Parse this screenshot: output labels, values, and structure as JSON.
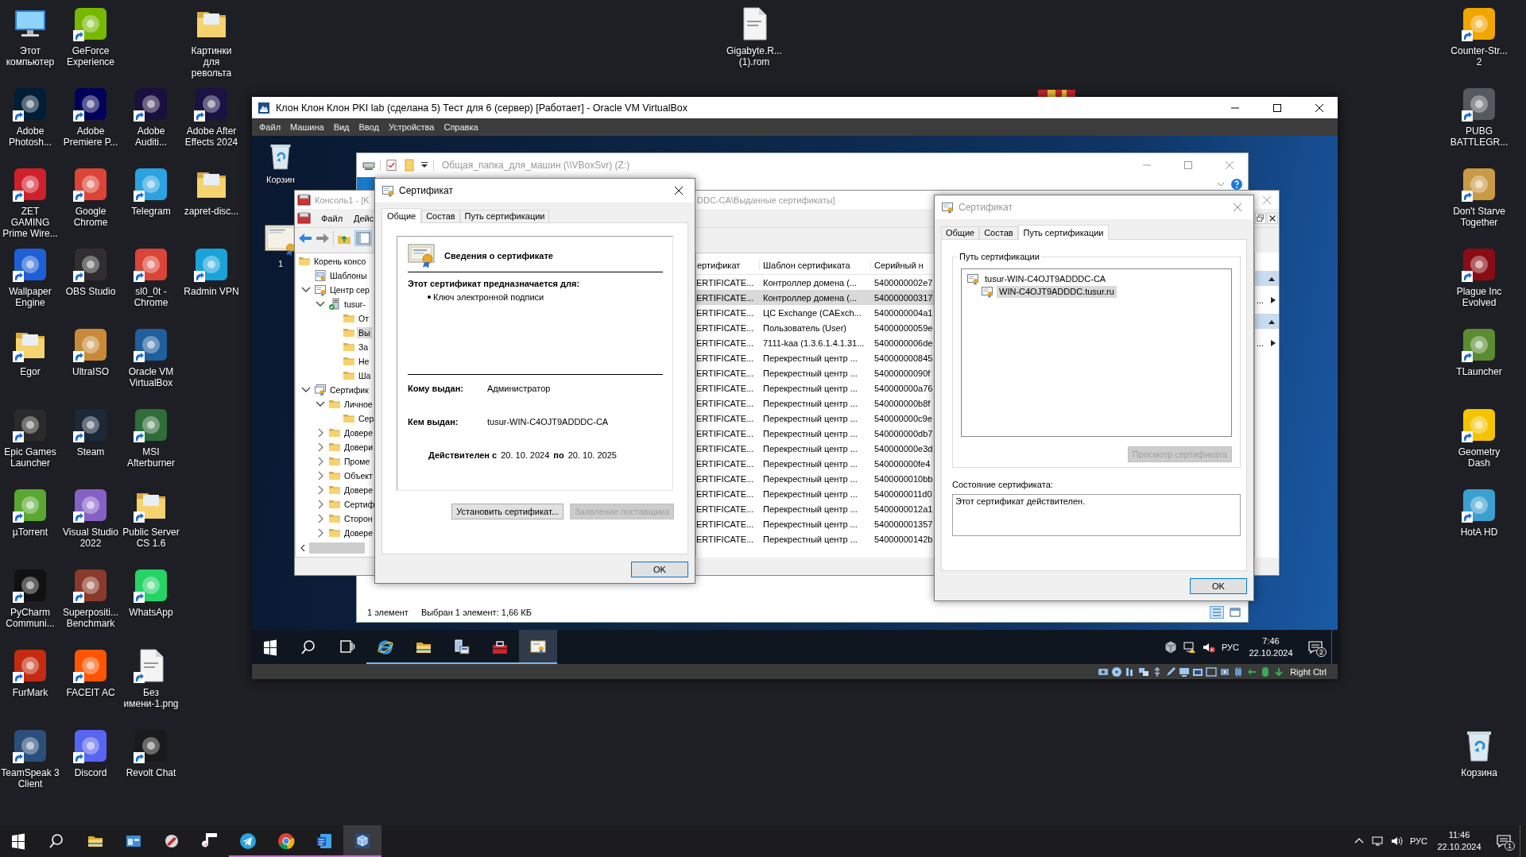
{
  "desktop_columns": [
    [
      {
        "label": "Этот компьютер",
        "kind": "computer",
        "shortcut": false
      },
      {
        "label": "Adobe Photosh...",
        "kind": "app",
        "color": "#001e36",
        "shortcut": true
      },
      {
        "label": "ZET GAMING Prime Wire...",
        "kind": "app",
        "color": "#d0202a",
        "shortcut": true
      },
      {
        "label": "Wallpaper Engine",
        "kind": "app",
        "color": "#1f5fd6",
        "shortcut": true
      },
      {
        "label": "Egor",
        "kind": "folder",
        "shortcut": true
      },
      {
        "label": "Epic Games Launcher",
        "kind": "app",
        "color": "#2a2a2a",
        "shortcut": true
      },
      {
        "label": "µTorrent",
        "kind": "app",
        "color": "#5aa832",
        "shortcut": true
      },
      {
        "label": "PyCharm Communi...",
        "kind": "app",
        "color": "#111111",
        "shortcut": true
      },
      {
        "label": "FurMark",
        "kind": "app",
        "color": "#c42b10",
        "shortcut": true
      },
      {
        "label": "TeamSpeak 3 Client",
        "kind": "app",
        "color": "#2b4f7a",
        "shortcut": true
      }
    ],
    [
      {
        "label": "GeForce Experience",
        "kind": "app",
        "color": "#76b900",
        "shortcut": true
      },
      {
        "label": "Adobe Premiere P...",
        "kind": "app",
        "color": "#00005b",
        "shortcut": true
      },
      {
        "label": "Google Chrome",
        "kind": "app",
        "color": "#db4437",
        "shortcut": true
      },
      {
        "label": "OBS Studio",
        "kind": "app",
        "color": "#302e31",
        "shortcut": true
      },
      {
        "label": "UltraISO",
        "kind": "app",
        "color": "#c88a3a",
        "shortcut": true
      },
      {
        "label": "Steam",
        "kind": "app",
        "color": "#1b2838",
        "shortcut": true
      },
      {
        "label": "Visual Studio 2022",
        "kind": "app",
        "color": "#8661c5",
        "shortcut": true
      },
      {
        "label": "Superpositi... Benchmark",
        "kind": "app",
        "color": "#8a3a2a",
        "shortcut": true
      },
      {
        "label": "FACEIT AC",
        "kind": "app",
        "color": "#ff5500",
        "shortcut": true
      },
      {
        "label": "Discord",
        "kind": "app",
        "color": "#5865f2",
        "shortcut": true
      }
    ],
    [
      {
        "label": "Adobe Auditi...",
        "kind": "app",
        "color": "#1a0f3f",
        "shortcut": true
      },
      {
        "label": "Telegram",
        "kind": "app",
        "color": "#2aa3e0",
        "shortcut": true
      },
      {
        "label": "sl0_0t - Chrome",
        "kind": "app",
        "color": "#db4438",
        "shortcut": true
      },
      {
        "label": "Oracle VM VirtualBox",
        "kind": "app",
        "color": "#1f5f9e",
        "shortcut": true
      },
      {
        "label": "MSI Afterburner",
        "kind": "app",
        "color": "#2f6d3a",
        "shortcut": true
      },
      {
        "label": "Public Server CS 1.6",
        "kind": "folder",
        "shortcut": true
      },
      {
        "label": "WhatsApp",
        "kind": "app",
        "color": "#25d366",
        "shortcut": true
      },
      {
        "label": "Без имени-1.png",
        "kind": "file",
        "shortcut": true
      },
      {
        "label": "Revolt Chat",
        "kind": "app",
        "color": "#1a1a1a",
        "shortcut": true
      }
    ],
    [
      {
        "label": "Картинки для револьта",
        "kind": "folder",
        "shortcut": false
      },
      {
        "label": "Adobe After Effects 2024",
        "kind": "app",
        "color": "#1a1145",
        "shortcut": true
      },
      {
        "label": "zapret-disc...",
        "kind": "folder",
        "shortcut": false
      },
      {
        "label": "Radmin VPN",
        "kind": "app",
        "color": "#1aa3d9",
        "shortcut": true
      }
    ]
  ],
  "desktop_file": {
    "label": "Gigabyte.R... (1).rom",
    "kind": "file",
    "shortcut": false
  },
  "desktop_right": [
    {
      "label": "Counter-Str... 2",
      "kind": "app",
      "color": "#f0a500",
      "shortcut": true
    },
    {
      "label": "PUBG BATTLEGR...",
      "kind": "app",
      "color": "#555a60",
      "shortcut": true
    },
    {
      "label": "Don't Starve Together",
      "kind": "app",
      "color": "#c99a45",
      "shortcut": true
    },
    {
      "label": "Plague Inc Evolved",
      "kind": "app",
      "color": "#8a0d14",
      "shortcut": true
    },
    {
      "label": "TLauncher",
      "kind": "app",
      "color": "#5b8c32",
      "shortcut": true
    },
    {
      "label": "Geometry Dash",
      "kind": "app",
      "color": "#f5c400",
      "shortcut": true
    },
    {
      "label": "HotA HD",
      "kind": "app",
      "color": "#3ba0d0",
      "shortcut": true
    }
  ],
  "recycle_bin": {
    "label": "Корзина",
    "kind": "bin",
    "shortcut": false
  },
  "vbox": {
    "title": "Клон Клон Клон PKI lab (сделана 5) Тест для 6 (сервер) [Работает] - Oracle VM VirtualBox",
    "menu": [
      "Файл",
      "Машина",
      "Вид",
      "Ввод",
      "Устройства",
      "Справка"
    ],
    "guest": {
      "icons": [
        {
          "label": "Корзин",
          "kind": "bin"
        },
        {
          "label": "1",
          "kind": "cert"
        }
      ],
      "explorer": {
        "title": "Общая_папка_для_машин (\\\\VBoxSvr) (Z:)",
        "status_count": "1 элемент",
        "status_selection": "Выбран 1 элемент: 1,66 КБ"
      },
      "console": {
        "title": "Консоль1 - [K",
        "title_end": "DDC-CA\\Выданные сертификаты]",
        "menu": [
          "Файл",
          "Дейс"
        ],
        "tree": [
          {
            "label": "Корень консо",
            "kind": "folder",
            "selected": false,
            "children": [
              {
                "label": "Шаблоны",
                "kind": "templates",
                "selected": false
              },
              {
                "label": "Центр сер",
                "kind": "ca",
                "selected": false,
                "expanded": true,
                "children": [
                  {
                    "label": "tusur-",
                    "kind": "server",
                    "selected": false,
                    "expanded": true,
                    "children": [
                      {
                        "label": "От",
                        "kind": "folder",
                        "selected": false
                      },
                      {
                        "label": "Вы",
                        "kind": "folder",
                        "selected": true
                      },
                      {
                        "label": "За",
                        "kind": "folder",
                        "selected": false
                      },
                      {
                        "label": "Не",
                        "kind": "folder",
                        "selected": false
                      },
                      {
                        "label": "Ша",
                        "kind": "folder",
                        "selected": false
                      }
                    ]
                  }
                ]
              },
              {
                "label": "Сертифик",
                "kind": "certs",
                "selected": false,
                "expanded": true,
                "children": [
                  {
                    "label": "Личное",
                    "kind": "folder",
                    "selected": false,
                    "expanded": true,
                    "children": [
                      {
                        "label": "Сер",
                        "kind": "folder",
                        "selected": false
                      }
                    ]
                  },
                  {
                    "label": "Довере",
                    "kind": "folder",
                    "selected": false,
                    "expanded": false
                  },
                  {
                    "label": "Довери",
                    "kind": "folder",
                    "selected": false,
                    "expanded": false
                  },
                  {
                    "label": "Проме",
                    "kind": "folder",
                    "selected": false,
                    "expanded": false
                  },
                  {
                    "label": "Объект",
                    "kind": "folder",
                    "selected": false,
                    "expanded": false
                  },
                  {
                    "label": "Довере",
                    "kind": "folder",
                    "selected": false,
                    "expanded": false
                  },
                  {
                    "label": "Сертиф",
                    "kind": "folder",
                    "selected": false,
                    "expanded": false
                  },
                  {
                    "label": "Сторон",
                    "kind": "folder",
                    "selected": false,
                    "expanded": false
                  },
                  {
                    "label": "Довере",
                    "kind": "folder",
                    "selected": false,
                    "expanded": false
                  }
                ]
              }
            ]
          }
        ],
        "columns": [
          "ертификат",
          "Шаблон сертификата",
          "Серийный н"
        ],
        "rows": [
          {
            "cells": [
              "ERTIFICATE...",
              "Контроллер домена (...",
              "5400000002e7"
            ],
            "selected": false
          },
          {
            "cells": [
              "ERTIFICATE...",
              "Контроллер домена (...",
              "540000000317"
            ],
            "selected": true
          },
          {
            "cells": [
              "ERTIFICATE...",
              "ЦС Exchange (CAExch...",
              "5400000004a1"
            ],
            "selected": false
          },
          {
            "cells": [
              "ERTIFICATE...",
              "Пользователь (User)",
              "54000000059e"
            ],
            "selected": false
          },
          {
            "cells": [
              "ERTIFICATE...",
              "7111-kaa (1.3.6.1.4.1.31...",
              "5400000006de"
            ],
            "selected": false
          },
          {
            "cells": [
              "ERTIFICATE...",
              "Перекрестный центр ...",
              "540000000845"
            ],
            "selected": false
          },
          {
            "cells": [
              "ERTIFICATE...",
              "Перекрестный центр ...",
              "54000000090f"
            ],
            "selected": false
          },
          {
            "cells": [
              "ERTIFICATE...",
              "Перекрестный центр ...",
              "540000000a76"
            ],
            "selected": false
          },
          {
            "cells": [
              "ERTIFICATE...",
              "Перекрестный центр ...",
              "540000000b8f"
            ],
            "selected": false
          },
          {
            "cells": [
              "ERTIFICATE...",
              "Перекрестный центр ...",
              "540000000c9e"
            ],
            "selected": false
          },
          {
            "cells": [
              "ERTIFICATE...",
              "Перекрестный центр ...",
              "540000000db7"
            ],
            "selected": false
          },
          {
            "cells": [
              "ERTIFICATE...",
              "Перекрестный центр ...",
              "540000000e3d"
            ],
            "selected": false
          },
          {
            "cells": [
              "ERTIFICATE...",
              "Перекрестный центр ...",
              "540000000fe4"
            ],
            "selected": false
          },
          {
            "cells": [
              "ERTIFICATE...",
              "Перекрестный центр ...",
              "5400000010bb"
            ],
            "selected": false
          },
          {
            "cells": [
              "ERTIFICATE...",
              "Перекрестный центр ...",
              "5400000011d0"
            ],
            "selected": false
          },
          {
            "cells": [
              "ERTIFICATE...",
              "Перекрестный центр ...",
              "5400000012a1"
            ],
            "selected": false
          },
          {
            "cells": [
              "ERTIFICATE...",
              "Перекрестный центр ...",
              "540000001357"
            ],
            "selected": false
          },
          {
            "cells": [
              "ERTIFICATE...",
              "Перекрестный центр ...",
              "54000000142b"
            ],
            "selected": false
          }
        ],
        "actions": [
          "...",
          "..."
        ]
      },
      "dialogs": [
        {
          "kind": "general",
          "active": true,
          "title": "Сертификат",
          "tabs": [
            {
              "label": "Общие",
              "selected": true
            },
            {
              "label": "Состав",
              "selected": false
            },
            {
              "label": "Путь сертификации",
              "selected": false
            }
          ],
          "heading": "Сведения о сертификате",
          "purpose_title": "Этот сертификат предназначается для:",
          "purposes": [
            "Ключ электронной подписи"
          ],
          "fields": [
            {
              "label": "Кому выдан:",
              "value": "Администратор"
            },
            {
              "label": "Кем выдан:",
              "value": "tusur-WIN-C4OJT9ADDDC-CA"
            }
          ],
          "valid": {
            "from_label": "Действителен с",
            "from": "20. 10. 2024",
            "to_label": "по",
            "to": "20. 10. 2025"
          },
          "buttons": [
            {
              "label": "Установить сертификат...",
              "disabled": false
            },
            {
              "label": "Заявление поставщика",
              "disabled": true
            }
          ],
          "ok": "OK"
        },
        {
          "kind": "path",
          "active": false,
          "title": "Сертификат",
          "tabs": [
            {
              "label": "Общие",
              "selected": false
            },
            {
              "label": "Состав",
              "selected": false
            },
            {
              "label": "Путь сертификации",
              "selected": true
            }
          ],
          "group_label": "Путь сертификации",
          "path": [
            {
              "label": "tusur-WIN-C4OJT9ADDDC-CA",
              "selected": false,
              "children": [
                {
                  "label": "WIN-C4OJT9ADDDC.tusur.ru",
                  "selected": true
                }
              ]
            }
          ],
          "view_button": {
            "label": "Просмотр сертификата",
            "disabled": true
          },
          "status_label": "Состояние сертификата:",
          "status": "Этот сертификат действителен.",
          "ok": "OK"
        }
      ],
      "taskbar": {
        "items": [
          {
            "kind": "start",
            "open": false,
            "active": false
          },
          {
            "kind": "search",
            "open": false,
            "active": false
          },
          {
            "kind": "task-view",
            "open": false,
            "active": false
          },
          {
            "kind": "browser",
            "open": true,
            "active": false
          },
          {
            "kind": "explorer",
            "open": true,
            "active": false
          },
          {
            "kind": "server-manager",
            "open": true,
            "active": false
          },
          {
            "kind": "toolbox",
            "open": true,
            "active": false
          },
          {
            "kind": "certificate",
            "open": true,
            "active": true
          }
        ],
        "language": "РУС",
        "time": "7:46",
        "date": "22.10.2024",
        "notifications": "2"
      }
    },
    "host_key": "Right Ctrl"
  },
  "taskbar": {
    "items": [
      {
        "kind": "start",
        "open": false,
        "active": false
      },
      {
        "kind": "search",
        "open": false,
        "active": false
      },
      {
        "kind": "explorer",
        "open": false,
        "active": false
      },
      {
        "kind": "window-app",
        "open": false,
        "active": false
      },
      {
        "kind": "brush-app",
        "open": false,
        "active": false
      },
      {
        "kind": "music-app",
        "open": false,
        "active": false
      },
      {
        "kind": "telegram",
        "open": true,
        "active": false
      },
      {
        "kind": "chrome",
        "open": true,
        "active": false
      },
      {
        "kind": "word",
        "open": true,
        "active": false
      },
      {
        "kind": "virtualbox",
        "open": true,
        "active": true
      }
    ],
    "language": "РУС",
    "time": "11:46",
    "date": "22.10.2024",
    "notifications": "1"
  }
}
